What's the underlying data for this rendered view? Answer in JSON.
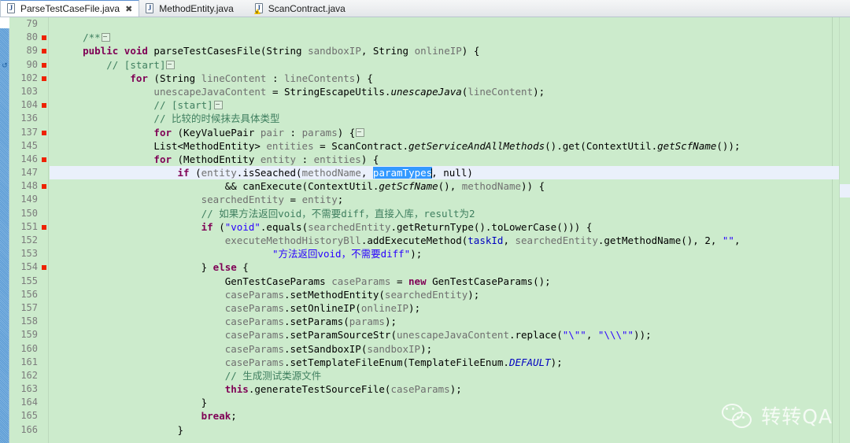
{
  "window": {
    "app": "Eclipse IDE - Java Editor"
  },
  "tabs": [
    {
      "label": "ParseTestCaseFile.java",
      "icon": "java-file-icon",
      "active": true,
      "closable": true,
      "close_glyph": "✖",
      "warning": false
    },
    {
      "label": "MethodEntity.java",
      "icon": "java-file-icon",
      "active": false,
      "closable": false,
      "close_glyph": "",
      "warning": false
    },
    {
      "label": "ScanContract.java",
      "icon": "java-file-warning-icon",
      "active": false,
      "closable": false,
      "close_glyph": "",
      "warning": true
    }
  ],
  "editor": {
    "selected_text": "paramTypes",
    "highlighted_line": 147,
    "colors": {
      "background": "#ccebcc",
      "highlight_line": "#eaf0fb",
      "selection": "#3399ff",
      "keyword": "#7f0055",
      "comment": "#3f7f5f",
      "string": "#2a00ff",
      "field": "#0000c0",
      "breakpoint": "#ee2200",
      "changebar": "#5b9bd5"
    },
    "lines": [
      {
        "num": "79",
        "marker": false,
        "text": ""
      },
      {
        "num": "80",
        "marker": true,
        "text": "    /**□"
      },
      {
        "num": "89",
        "marker": true,
        "text": "    public void parseTestCasesFile(String sandboxIP, String onlineIP) {"
      },
      {
        "num": "90",
        "marker": true,
        "text": "        // [start]□"
      },
      {
        "num": "102",
        "marker": true,
        "text": "            for (String lineContent : lineContents) {"
      },
      {
        "num": "103",
        "marker": false,
        "text": "                unescapeJavaContent = StringEscapeUtils.unescapeJava(lineContent);"
      },
      {
        "num": "104",
        "marker": true,
        "text": "                // [start]□"
      },
      {
        "num": "136",
        "marker": false,
        "text": "                // 比较的时候抹去具体类型"
      },
      {
        "num": "137",
        "marker": true,
        "text": "                for (KeyValuePair pair : params) {□"
      },
      {
        "num": "145",
        "marker": false,
        "text": "                List<MethodEntity> entities = ScanContract.getServiceAndAllMethods().get(ContextUtil.getScfName());"
      },
      {
        "num": "146",
        "marker": true,
        "text": "                for (MethodEntity entity : entities) {"
      },
      {
        "num": "147",
        "marker": false,
        "text": "                    if (entity.isSeached(methodName, paramTypes, null)"
      },
      {
        "num": "148",
        "marker": true,
        "text": "                            && canExecute(ContextUtil.getScfName(), methodName)) {"
      },
      {
        "num": "149",
        "marker": false,
        "text": "                        searchedEntity = entity;"
      },
      {
        "num": "150",
        "marker": false,
        "text": "                        // 如果方法返回void，不需要diff，直接入库，result为2"
      },
      {
        "num": "151",
        "marker": true,
        "text": "                        if (\"void\".equals(searchedEntity.getReturnType().toLowerCase())) {"
      },
      {
        "num": "152",
        "marker": false,
        "text": "                            executeMethodHistoryBll.addExecuteMethod(taskId, searchedEntity.getMethodName(), 2, \"\","
      },
      {
        "num": "153",
        "marker": false,
        "text": "                                    \"方法返回void，不需要diff\");"
      },
      {
        "num": "154",
        "marker": true,
        "text": "                        } else {"
      },
      {
        "num": "155",
        "marker": false,
        "text": "                            GenTestCaseParams caseParams = new GenTestCaseParams();"
      },
      {
        "num": "156",
        "marker": false,
        "text": "                            caseParams.setMethodEntity(searchedEntity);"
      },
      {
        "num": "157",
        "marker": false,
        "text": "                            caseParams.setOnlineIP(onlineIP);"
      },
      {
        "num": "158",
        "marker": false,
        "text": "                            caseParams.setParams(params);"
      },
      {
        "num": "159",
        "marker": false,
        "text": "                            caseParams.setParamSourceStr(unescapeJavaContent.replace(\"\\\"\", \"\\\\\\\"\"));"
      },
      {
        "num": "160",
        "marker": false,
        "text": "                            caseParams.setSandboxIP(sandboxIP);"
      },
      {
        "num": "161",
        "marker": false,
        "text": "                            caseParams.setTemplateFileEnum(TemplateFileEnum.DEFAULT);"
      },
      {
        "num": "162",
        "marker": false,
        "text": "                            // 生成测试类源文件"
      },
      {
        "num": "163",
        "marker": false,
        "text": "                            this.generateTestSourceFile(caseParams);"
      },
      {
        "num": "164",
        "marker": false,
        "text": "                        }"
      },
      {
        "num": "165",
        "marker": false,
        "text": "                        break;"
      },
      {
        "num": "166",
        "marker": false,
        "text": "                    }"
      }
    ]
  },
  "watermark": {
    "text": "转转QA",
    "icon": "wechat-icon"
  }
}
